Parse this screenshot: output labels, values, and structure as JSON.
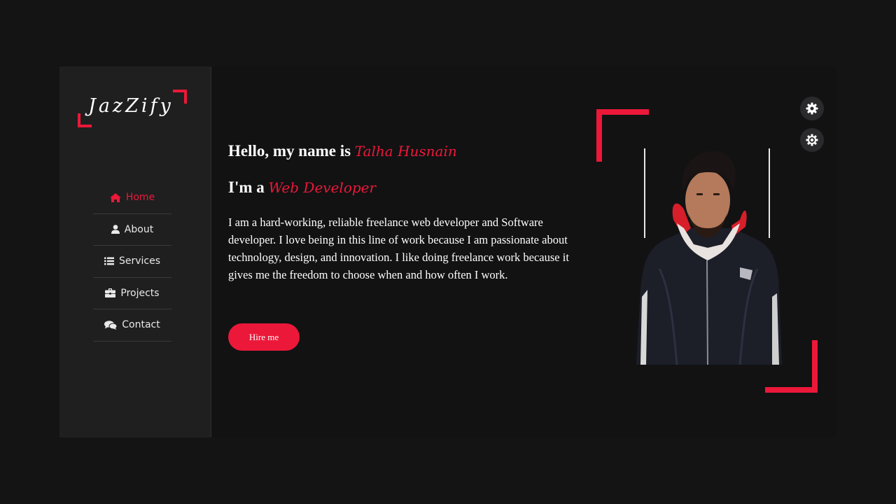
{
  "brand": {
    "logo_text": "JazZify"
  },
  "nav": {
    "items": [
      {
        "label": "Home",
        "icon": "home-icon",
        "active": true
      },
      {
        "label": "About",
        "icon": "user-icon",
        "active": false
      },
      {
        "label": "Services",
        "icon": "list-icon",
        "active": false
      },
      {
        "label": "Projects",
        "icon": "briefcase-icon",
        "active": false
      },
      {
        "label": "Contact",
        "icon": "comments-icon",
        "active": false
      }
    ]
  },
  "hero": {
    "greeting_prefix": "Hello, my name is ",
    "name": "Talha Husnain",
    "role_prefix": "I'm a ",
    "role": "Web Developer",
    "bio": "I am a hard-working, reliable freelance web developer and Software developer. I love being in this line of work because I am passionate about technology, design, and innovation. I like doing freelance work because it gives me the freedom to choose when and how often I work.",
    "cta_label": "Hire me"
  },
  "colors": {
    "accent": "#ec1839",
    "background": "#141415",
    "sidebar": "#1f1f1f"
  },
  "tools": {
    "icons": [
      "cog-icon",
      "theme-gear-icon"
    ]
  }
}
